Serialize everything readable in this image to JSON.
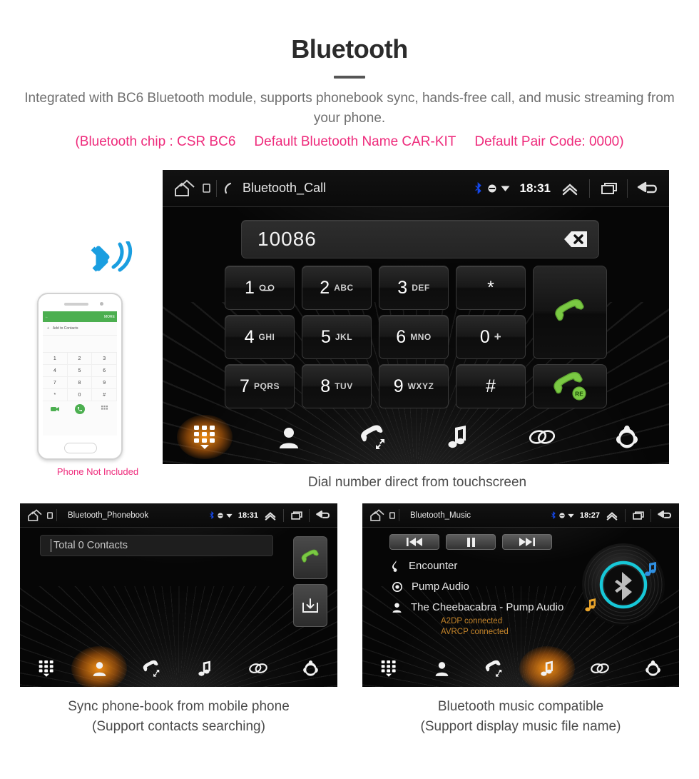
{
  "header": {
    "title": "Bluetooth",
    "subtitle": "Integrated with BC6 Bluetooth module, supports phonebook sync, hands-free call, and music streaming from your phone.",
    "specs": [
      "(Bluetooth chip : CSR BC6",
      "Default Bluetooth Name CAR-KIT",
      "Default Pair Code: 0000)"
    ],
    "accent_pink": "#ee2a7b",
    "body_gray": "#6e6e6e"
  },
  "call_panel": {
    "statusbar": {
      "title": "Bluetooth_Call",
      "clock": "18:31",
      "icons": [
        "home-icon",
        "sdcard-icon",
        "phone-handset-icon",
        "bluetooth-icon",
        "sync-icon",
        "wifi-icon",
        "collapse-up-icon",
        "recents-icon",
        "back-icon"
      ]
    },
    "number_field": {
      "value": "10086",
      "backspace_label": "backspace-icon"
    },
    "keys": [
      {
        "num": "1",
        "sub": "∞",
        "name": "key-1"
      },
      {
        "num": "2",
        "sub": "ABC",
        "name": "key-2"
      },
      {
        "num": "3",
        "sub": "DEF",
        "name": "key-3"
      },
      {
        "num": "*",
        "sub": "",
        "name": "key-star"
      },
      {
        "num": "4",
        "sub": "GHI",
        "name": "key-4"
      },
      {
        "num": "5",
        "sub": "JKL",
        "name": "key-5"
      },
      {
        "num": "6",
        "sub": "MNO",
        "name": "key-6"
      },
      {
        "num": "0",
        "sub": "+",
        "name": "key-0"
      },
      {
        "num": "7",
        "sub": "PQRS",
        "name": "key-7"
      },
      {
        "num": "8",
        "sub": "TUV",
        "name": "key-8"
      },
      {
        "num": "9",
        "sub": "WXYZ",
        "name": "key-9"
      },
      {
        "num": "#",
        "sub": "",
        "name": "key-hash"
      }
    ],
    "call_button": "call-icon",
    "redial_button": "redial-icon",
    "redial_badge": "RE",
    "toolbar": [
      {
        "icon": "dialpad-icon",
        "active": true
      },
      {
        "icon": "contacts-icon",
        "active": false
      },
      {
        "icon": "call-history-icon",
        "active": false
      },
      {
        "icon": "music-note-icon",
        "active": false
      },
      {
        "icon": "link-icon",
        "active": false
      },
      {
        "icon": "settings-gear-icon",
        "active": false
      }
    ]
  },
  "phone_illustration": {
    "caption": "Phone Not Included",
    "screen": {
      "more_label": "MORE",
      "add_contact_label": "Add to Contacts",
      "keys": [
        "1",
        "2",
        "3",
        "4",
        "5",
        "6",
        "7",
        "8",
        "9",
        "*",
        "0",
        "#"
      ]
    },
    "bluetooth_signal_icon": "bluetooth-signal-icon",
    "bluetooth_color": "#1a9ee0"
  },
  "captions": {
    "call": "Dial number direct from touchscreen",
    "phonebook_line1": "Sync phone-book from mobile phone",
    "phonebook_line2": "(Support contacts searching)",
    "music_line1": "Bluetooth music compatible",
    "music_line2": "(Support display music file name)"
  },
  "phonebook_panel": {
    "statusbar": {
      "title": "Bluetooth_Phonebook",
      "clock": "18:31"
    },
    "search_text": "Total 0 Contacts",
    "side_buttons": [
      {
        "icon": "call-icon",
        "name": "phonebook-call-button"
      },
      {
        "icon": "download-contacts-icon",
        "name": "phonebook-download-button"
      }
    ],
    "toolbar": [
      {
        "icon": "dialpad-icon",
        "active": false
      },
      {
        "icon": "contacts-icon",
        "active": true
      },
      {
        "icon": "call-history-icon",
        "active": false
      },
      {
        "icon": "music-note-icon",
        "active": false
      },
      {
        "icon": "link-icon",
        "active": false
      },
      {
        "icon": "settings-gear-icon",
        "active": false
      }
    ]
  },
  "music_panel": {
    "statusbar": {
      "title": "Bluetooth_Music",
      "clock": "18:27"
    },
    "transport": [
      {
        "icon": "previous-track-icon",
        "name": "previous-button"
      },
      {
        "icon": "pause-icon",
        "name": "pause-button"
      },
      {
        "icon": "next-track-icon",
        "name": "next-button"
      }
    ],
    "track": {
      "title": "Encounter",
      "album": "Pump Audio",
      "artist": "The Cheebacabra - Pump Audio"
    },
    "status": [
      "A2DP connected",
      "AVRCP connected"
    ],
    "status_color": "#c4842a",
    "disc_icon": "bluetooth-vinyl-icon",
    "toolbar": [
      {
        "icon": "dialpad-icon",
        "active": false
      },
      {
        "icon": "contacts-icon",
        "active": false
      },
      {
        "icon": "call-history-icon",
        "active": false
      },
      {
        "icon": "music-note-icon",
        "active": true
      },
      {
        "icon": "link-icon",
        "active": false
      },
      {
        "icon": "settings-gear-icon",
        "active": false
      }
    ]
  }
}
